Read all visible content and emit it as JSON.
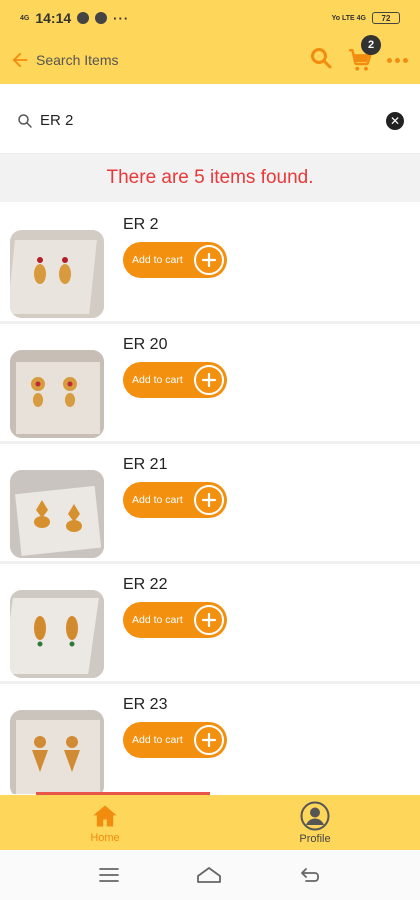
{
  "status": {
    "signal_left": "4G",
    "time": "14:14",
    "more": "···",
    "network": "Yo LTE 4G",
    "battery": "72"
  },
  "appbar": {
    "title": "Search Items",
    "cart_count": "2",
    "accent": "#f28c0f",
    "background": "#fdd65a"
  },
  "search": {
    "query": "ER 2",
    "placeholder": ""
  },
  "results": {
    "message": "There are 5 items found.",
    "message_color": "#e8393a"
  },
  "items": [
    {
      "name": "ER 2",
      "button": "Add to cart"
    },
    {
      "name": "ER 20",
      "button": "Add to cart"
    },
    {
      "name": "ER 21",
      "button": "Add to cart"
    },
    {
      "name": "ER 22",
      "button": "Add to cart"
    },
    {
      "name": "ER 23",
      "button": "Add to cart"
    }
  ],
  "bottom_nav": {
    "home": "Home",
    "profile": "Profile"
  }
}
